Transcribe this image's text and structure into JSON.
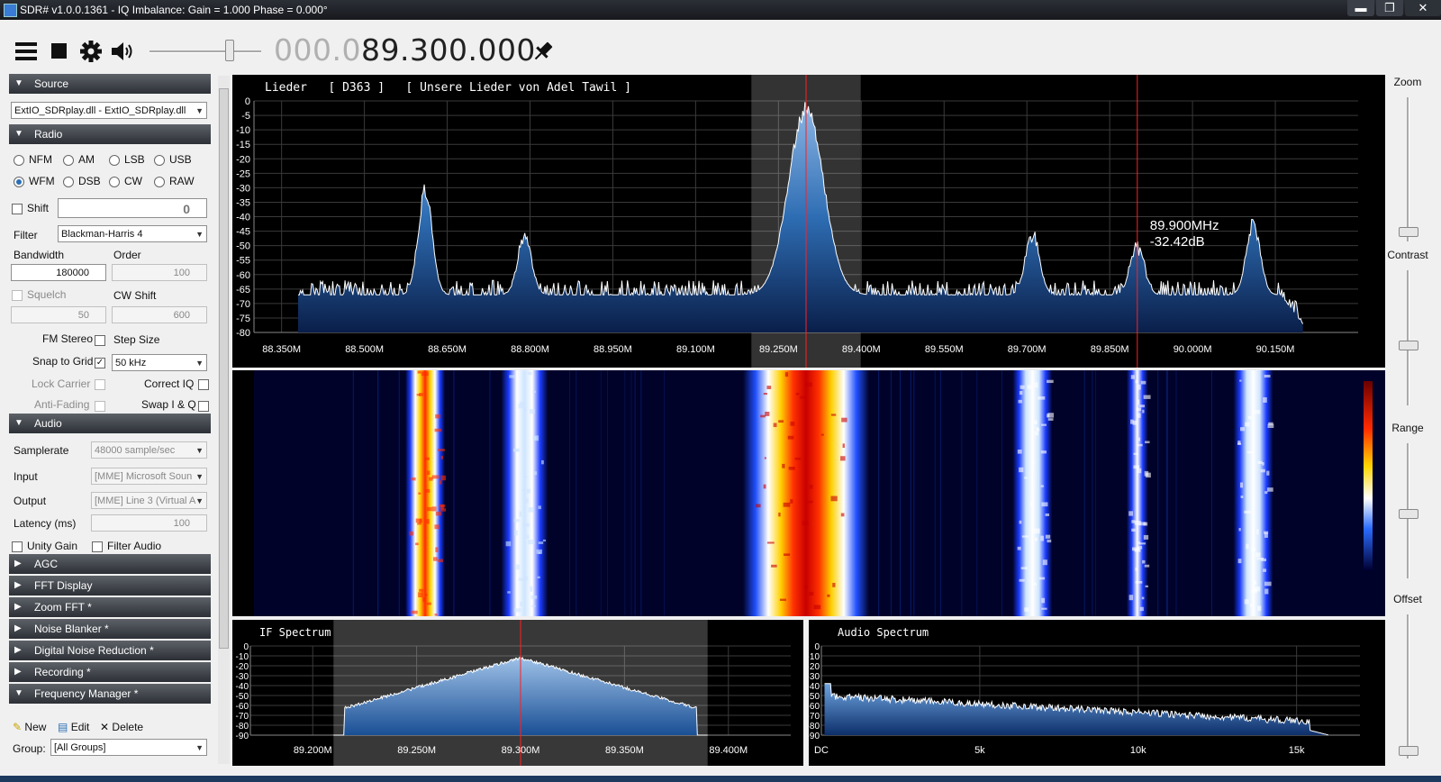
{
  "window": {
    "title": "SDR# v1.0.0.1361 - IQ Imbalance: Gain = 1.000 Phase = 0.000°",
    "min_label": "▬",
    "max_label": "❐",
    "close_label": "✕"
  },
  "toolbar": {
    "freq_dim": "000.0",
    "freq_main": "89.300.000",
    "icons": [
      "menu-icon",
      "stop-icon",
      "gear-icon",
      "speaker-icon",
      "pin-icon"
    ],
    "volume": 0.72
  },
  "sections": {
    "source": "Source",
    "radio": "Radio",
    "audio": "Audio",
    "agc": "AGC",
    "fft_display": "FFT Display",
    "zoom_fft": "Zoom FFT *",
    "noise_blanker": "Noise Blanker *",
    "dnr": "Digital Noise Reduction *",
    "recording": "Recording *",
    "freq_manager": "Frequency Manager *"
  },
  "source": {
    "device": "ExtIO_SDRplay.dll - ExtIO_SDRplay.dll"
  },
  "radio": {
    "modes": [
      "NFM",
      "AM",
      "LSB",
      "USB",
      "WFM",
      "DSB",
      "CW",
      "RAW"
    ],
    "selected_mode": "WFM",
    "shift_label": "Shift",
    "shift_value": "0",
    "filter_label": "Filter",
    "filter_value": "Blackman-Harris 4",
    "bandwidth_label": "Bandwidth",
    "bandwidth_value": "180000",
    "order_label": "Order",
    "order_value": "100",
    "squelch_label": "Squelch",
    "squelch_value": "50",
    "cwshift_label": "CW Shift",
    "cwshift_value": "600",
    "fm_stereo_label": "FM Stereo",
    "step_size_label": "Step Size",
    "snap_label": "Snap to Grid",
    "snap_value": "50 kHz",
    "lock_carrier_label": "Lock Carrier",
    "correct_iq_label": "Correct IQ",
    "anti_fading_label": "Anti-Fading",
    "swap_iq_label": "Swap I & Q"
  },
  "audio": {
    "samplerate_label": "Samplerate",
    "samplerate_value": "48000 sample/sec",
    "input_label": "Input",
    "input_value": "[MME] Microsoft Soun",
    "output_label": "Output",
    "output_value": "[MME] Line 3 (Virtual A",
    "latency_label": "Latency (ms)",
    "latency_value": "100",
    "unity_gain_label": "Unity Gain",
    "filter_audio_label": "Filter Audio"
  },
  "freq_manager": {
    "new_label": "New",
    "edit_label": "Edit",
    "delete_label": "Delete",
    "group_label": "Group:",
    "group_value": "[All Groups]"
  },
  "spectrum": {
    "rds_text": "Lieder   [ D363 ]   [ Unsere Lieder von Adel Tawil ]",
    "cursor_freq": "89.900MHz",
    "cursor_db": "-32.42dB",
    "db_ticks": [
      "0",
      "-5",
      "-10",
      "-15",
      "-20",
      "-25",
      "-30",
      "-35",
      "-40",
      "-45",
      "-50",
      "-55",
      "-60",
      "-65",
      "-70",
      "-75",
      "-80"
    ],
    "freq_ticks": [
      "88.350M",
      "88.500M",
      "88.650M",
      "88.800M",
      "88.950M",
      "89.100M",
      "89.250M",
      "89.400M",
      "89.550M",
      "89.700M",
      "89.850M",
      "90.000M",
      "90.150M"
    ]
  },
  "if_spectrum": {
    "title": "IF Spectrum",
    "db_ticks": [
      "0",
      "-10",
      "-20",
      "-30",
      "-40",
      "-50",
      "-60",
      "-70",
      "-80",
      "-90"
    ],
    "freq_ticks": [
      "89.200M",
      "89.250M",
      "89.300M",
      "89.350M",
      "89.400M"
    ]
  },
  "audio_spectrum": {
    "title": "Audio Spectrum",
    "db_ticks": [
      "0",
      "-10",
      "-20",
      "-30",
      "-40",
      "-50",
      "-60",
      "-70",
      "-80",
      "-90"
    ],
    "freq_ticks": [
      "DC",
      "5k",
      "10k",
      "15k"
    ]
  },
  "right_sliders": {
    "zoom": "Zoom",
    "contrast": "Contrast",
    "range": "Range",
    "offset": "Offset"
  },
  "chart_data": {
    "type": "line",
    "title": "Lieder [ D363 ] [ Unsere Lieder von Adel Tawil ]",
    "xlabel": "",
    "ylabel": "",
    "x_unit": "MHz",
    "xlim": [
      88.3,
      90.3
    ],
    "ylim": [
      -80,
      0
    ],
    "center_freq": 89.3,
    "cursor_freq": 89.9,
    "peaks": [
      {
        "freq": 88.61,
        "db": -31
      },
      {
        "freq": 88.79,
        "db": -47
      },
      {
        "freq": 89.3,
        "db": -3
      },
      {
        "freq": 89.71,
        "db": -46
      },
      {
        "freq": 89.9,
        "db": -50
      },
      {
        "freq": 90.11,
        "db": -43
      }
    ],
    "noise_floor_db": -67
  }
}
